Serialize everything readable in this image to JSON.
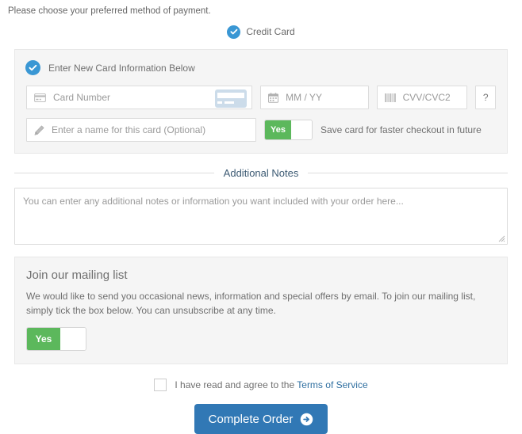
{
  "intro": {
    "text": "Please choose your preferred method of payment."
  },
  "payment_method": {
    "selected_label": "Credit Card",
    "check_icon": "check-circle-icon",
    "accent_color": "#3a97d4"
  },
  "card_panel": {
    "header_label": "Enter New Card Information Below",
    "header_icon": "check-circle-icon",
    "fields": {
      "card_number": {
        "placeholder": "Card Number",
        "value": "",
        "icon": "credit-card-icon",
        "art_icon": "credit-card-graphic"
      },
      "expiry": {
        "placeholder": "MM / YY",
        "value": "",
        "icon": "calendar-icon"
      },
      "cvv": {
        "placeholder": "CVV/CVC2",
        "value": "",
        "icon": "cvv-bars-icon"
      },
      "help_button": {
        "label": "?",
        "icon": "question-mark-icon"
      },
      "card_name": {
        "placeholder": "Enter a name for this card (Optional)",
        "value": "",
        "icon": "pencil-icon"
      }
    },
    "save_card_toggle": {
      "state_label": "Yes",
      "caption": "Save card for faster checkout in future",
      "on_color": "#5cb85c"
    },
    "panel_bg": "#f5f5f5"
  },
  "additional_notes": {
    "heading": "Additional Notes",
    "placeholder": "You can enter any additional notes or information you want included with your order here...",
    "value": "",
    "resize_icon": "resize-grip-icon"
  },
  "mailing_list": {
    "title": "Join our mailing list",
    "description": "We would like to send you occasional news, information and special offers by email. To join our mailing list, simply tick the box below. You can unsubscribe at any time.",
    "toggle": {
      "state_label": "Yes",
      "on_color": "#5cb85c"
    }
  },
  "terms": {
    "checkbox_checked": false,
    "text": "I have read and agree to the",
    "link_label": "Terms of Service",
    "link_color": "#2f6fa0"
  },
  "submit": {
    "label": "Complete Order",
    "icon": "arrow-circle-right-icon",
    "color": "#3178b5"
  }
}
